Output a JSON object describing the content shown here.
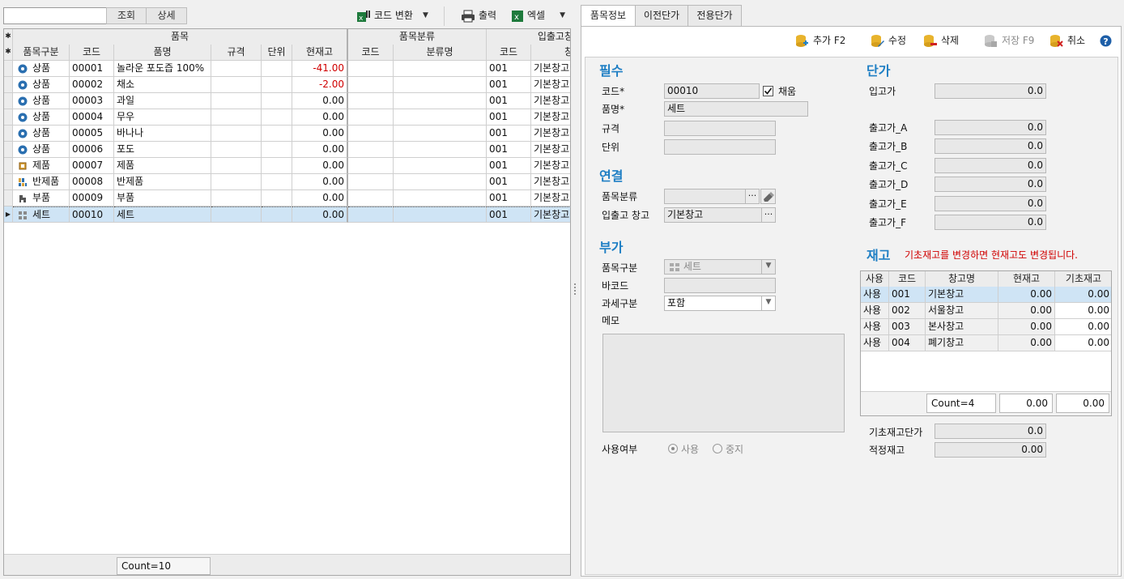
{
  "toolbar": {
    "search_button": "조회",
    "detail_button": "상세",
    "code_convert": "코드 변환",
    "print": "출력",
    "excel": "엑셀"
  },
  "grid": {
    "group_headers": [
      "품목",
      "품목분류",
      "입출고창"
    ],
    "columns": [
      "품목구분",
      "코드",
      "품명",
      "규격",
      "단위",
      "현재고",
      "코드",
      "분류명",
      "코드",
      "창"
    ],
    "rows": [
      {
        "type": "상품",
        "icon": "circle-item-icon",
        "code": "00001",
        "name": "놀라운 포도즙 100%",
        "spec": "",
        "unit": "",
        "stock": "-41.00",
        "neg": true,
        "cat_code": "",
        "cat_name": "",
        "wh_code": "001",
        "wh_name": "기본창고"
      },
      {
        "type": "상품",
        "icon": "circle-item-icon",
        "code": "00002",
        "name": "채소",
        "spec": "",
        "unit": "",
        "stock": "-2.00",
        "neg": true,
        "cat_code": "",
        "cat_name": "",
        "wh_code": "001",
        "wh_name": "기본창고"
      },
      {
        "type": "상품",
        "icon": "circle-item-icon",
        "code": "00003",
        "name": "과일",
        "spec": "",
        "unit": "",
        "stock": "0.00",
        "neg": false,
        "cat_code": "",
        "cat_name": "",
        "wh_code": "001",
        "wh_name": "기본창고"
      },
      {
        "type": "상품",
        "icon": "circle-item-icon",
        "code": "00004",
        "name": "무우",
        "spec": "",
        "unit": "",
        "stock": "0.00",
        "neg": false,
        "cat_code": "",
        "cat_name": "",
        "wh_code": "001",
        "wh_name": "기본창고"
      },
      {
        "type": "상품",
        "icon": "circle-item-icon",
        "code": "00005",
        "name": "바나나",
        "spec": "",
        "unit": "",
        "stock": "0.00",
        "neg": false,
        "cat_code": "",
        "cat_name": "",
        "wh_code": "001",
        "wh_name": "기본창고"
      },
      {
        "type": "상품",
        "icon": "circle-item-icon",
        "code": "00006",
        "name": "포도",
        "spec": "",
        "unit": "",
        "stock": "0.00",
        "neg": false,
        "cat_code": "",
        "cat_name": "",
        "wh_code": "001",
        "wh_name": "기본창고"
      },
      {
        "type": "제품",
        "icon": "chip-product-icon",
        "code": "00007",
        "name": "제품",
        "spec": "",
        "unit": "",
        "stock": "0.00",
        "neg": false,
        "cat_code": "",
        "cat_name": "",
        "wh_code": "001",
        "wh_name": "기본창고"
      },
      {
        "type": "반제품",
        "icon": "semi-product-icon",
        "code": "00008",
        "name": "반제품",
        "spec": "",
        "unit": "",
        "stock": "0.00",
        "neg": false,
        "cat_code": "",
        "cat_name": "",
        "wh_code": "001",
        "wh_name": "기본창고"
      },
      {
        "type": "부품",
        "icon": "part-icon",
        "code": "00009",
        "name": "부품",
        "spec": "",
        "unit": "",
        "stock": "0.00",
        "neg": false,
        "cat_code": "",
        "cat_name": "",
        "wh_code": "001",
        "wh_name": "기본창고"
      },
      {
        "type": "세트",
        "icon": "set-icon",
        "code": "00010",
        "name": "세트",
        "spec": "",
        "unit": "",
        "stock": "0.00",
        "neg": false,
        "cat_code": "",
        "cat_name": "",
        "wh_code": "001",
        "wh_name": "기본창고",
        "selected": true
      }
    ],
    "count": "Count=10"
  },
  "tabs": [
    "품목정보",
    "이전단가",
    "전용단가"
  ],
  "panel_toolbar": {
    "add": "추가 F2",
    "edit": "수정",
    "delete": "삭제",
    "save": "저장 F9",
    "cancel": "취소"
  },
  "required": {
    "title": "필수",
    "code_label": "코드*",
    "code_value": "00010",
    "auto_label": "채움",
    "auto_checked": true,
    "name_label": "품명*",
    "name_value": "세트",
    "spec_label": "규격",
    "spec_value": "",
    "unit_label": "단위",
    "unit_value": ""
  },
  "link": {
    "title": "연결",
    "category_label": "품목분류",
    "category_value": "",
    "warehouse_label": "입출고 창고",
    "warehouse_value": "기본창고"
  },
  "extra": {
    "title": "부가",
    "type_label": "품목구분",
    "type_value": "세트",
    "barcode_label": "바코드",
    "barcode_value": "",
    "tax_label": "과세구분",
    "tax_value": "포함",
    "memo_label": "메모",
    "use_label": "사용여부",
    "use_on": "사용",
    "use_off": "중지"
  },
  "price": {
    "title": "단가",
    "items": [
      {
        "label": "입고가",
        "value": "0.0"
      },
      {
        "label": "출고가_A",
        "value": "0.0"
      },
      {
        "label": "출고가_B",
        "value": "0.0"
      },
      {
        "label": "출고가_C",
        "value": "0.0"
      },
      {
        "label": "출고가_D",
        "value": "0.0"
      },
      {
        "label": "출고가_E",
        "value": "0.0"
      },
      {
        "label": "출고가_F",
        "value": "0.0"
      }
    ]
  },
  "stock": {
    "title": "재고",
    "notice": "기초재고를 변경하면 현재고도 변경됩니다.",
    "columns": [
      "사용",
      "코드",
      "창고명",
      "현재고",
      "기초재고"
    ],
    "rows": [
      {
        "use": "사용",
        "code": "001",
        "name": "기본창고",
        "current": "0.00",
        "base": "0.00"
      },
      {
        "use": "사용",
        "code": "002",
        "name": "서울창고",
        "current": "0.00",
        "base": "0.00"
      },
      {
        "use": "사용",
        "code": "003",
        "name": "본사창고",
        "current": "0.00",
        "base": "0.00"
      },
      {
        "use": "사용",
        "code": "004",
        "name": "폐기창고",
        "current": "0.00",
        "base": "0.00"
      }
    ],
    "count": "Count=4",
    "sum_current": "0.00",
    "sum_base": "0.00",
    "base_price_label": "기초재고단가",
    "base_price_value": "0.0",
    "proper_label": "적정재고",
    "proper_value": "0.00"
  },
  "colors": {
    "accent": "#1f7fc4",
    "negative": "#d00000",
    "selection": "#cfe4f5"
  }
}
